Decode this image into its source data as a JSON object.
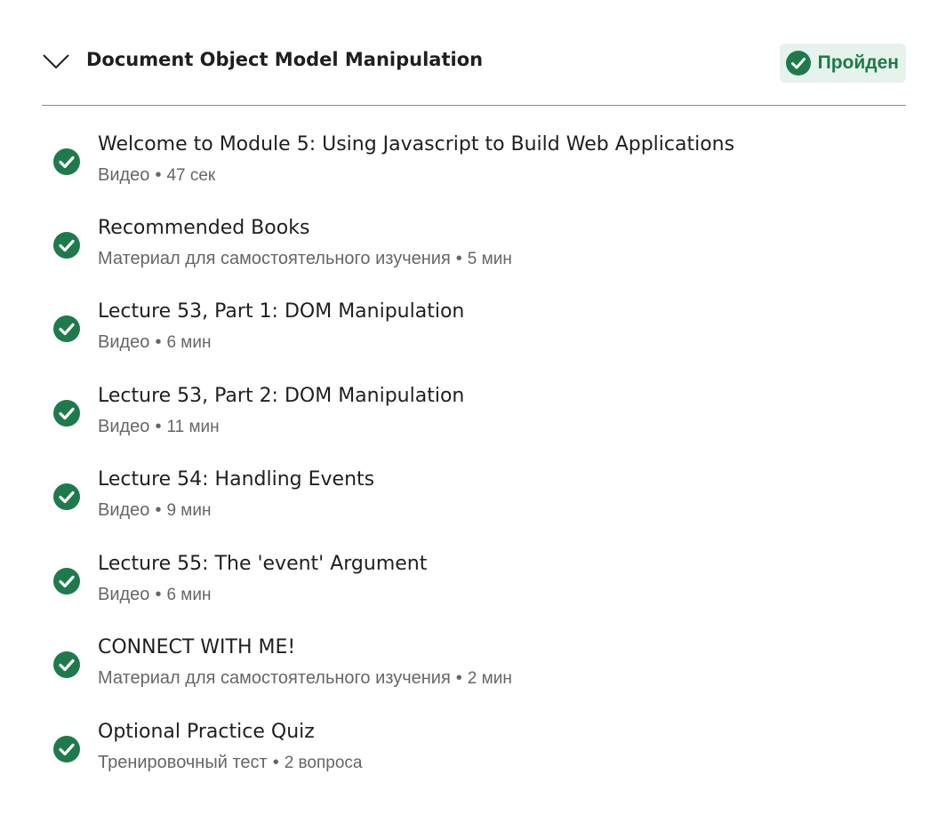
{
  "module": {
    "title": "Document Object Model Manipulation",
    "status": "Пройден",
    "expanded": true
  },
  "colors": {
    "accent_green": "#1e7a4c",
    "badge_bg": "#e6f3ec",
    "meta_gray": "#666666"
  },
  "icons": {
    "toggle": "chevron-down-icon",
    "completed": "check-circle-icon"
  },
  "items": [
    {
      "title": "Welcome to Module 5: Using Javascript to Build Web Applications",
      "type": "Видео",
      "separator": "•",
      "duration": "47 сек",
      "completed": true
    },
    {
      "title": "Recommended Books",
      "type": "Материал для самостоятельного изучения",
      "separator": "•",
      "duration": "5 мин",
      "completed": true
    },
    {
      "title": "Lecture 53, Part 1: DOM Manipulation",
      "type": "Видео",
      "separator": "•",
      "duration": "6 мин",
      "completed": true
    },
    {
      "title": "Lecture 53, Part 2: DOM Manipulation",
      "type": "Видео",
      "separator": "•",
      "duration": "11 мин",
      "completed": true
    },
    {
      "title": "Lecture 54: Handling Events",
      "type": "Видео",
      "separator": "•",
      "duration": "9 мин",
      "completed": true
    },
    {
      "title": "Lecture 55: The 'event' Argument",
      "type": "Видео",
      "separator": "•",
      "duration": "6 мин",
      "completed": true
    },
    {
      "title": "CONNECT WITH ME!",
      "type": "Материал для самостоятельного изучения",
      "separator": "•",
      "duration": "2 мин",
      "completed": true
    },
    {
      "title": "Optional Practice Quiz",
      "type": "Тренировочный тест",
      "separator": "•",
      "duration": "2 вопроса",
      "completed": true
    }
  ]
}
